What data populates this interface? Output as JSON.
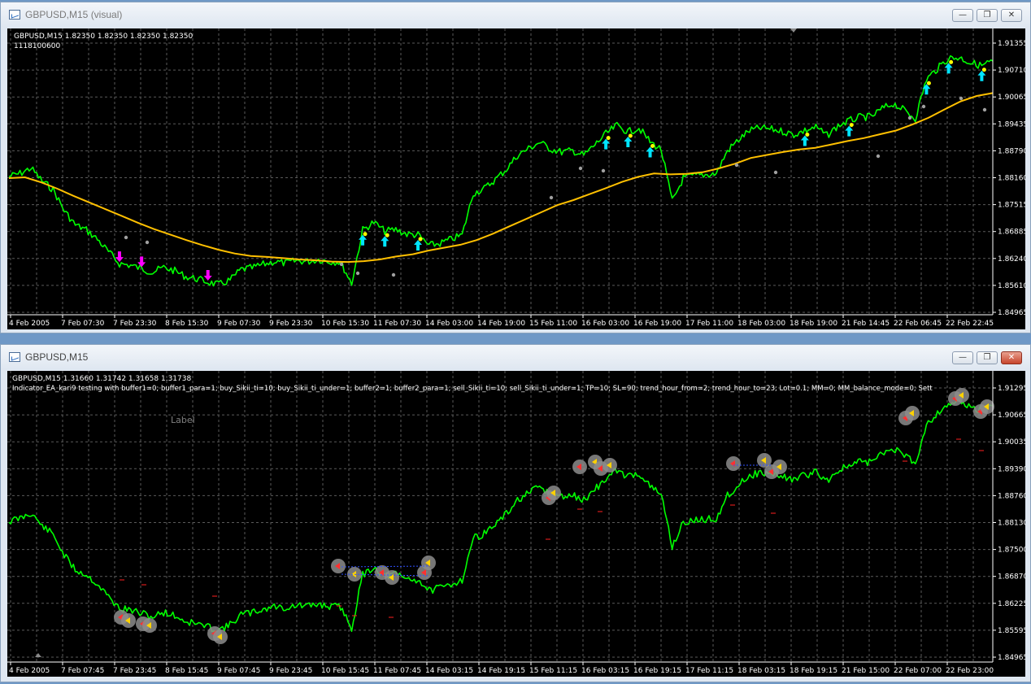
{
  "window_top": {
    "title": "GBPUSD,M15 (visual)",
    "header_line1": "GBPUSD,M15  1.82350 1.82350 1.82350 1.82350",
    "header_line2": "1118100600",
    "price_ticks": [
      "1.91355",
      "1.90710",
      "1.90065",
      "1.89435",
      "1.88790",
      "1.88160",
      "1.87515",
      "1.86885",
      "1.86240",
      "1.85610",
      "1.84965"
    ],
    "time_ticks": [
      "4 Feb 2005",
      "7 Feb 07:30",
      "7 Feb 23:30",
      "8 Feb 15:30",
      "9 Feb 07:30",
      "9 Feb 23:30",
      "10 Feb 15:30",
      "11 Feb 07:30",
      "14 Feb 03:00",
      "14 Feb 19:00",
      "15 Feb 11:00",
      "16 Feb 03:00",
      "16 Feb 19:00",
      "17 Feb 11:00",
      "18 Feb 03:00",
      "18 Feb 19:00",
      "21 Feb 14:45",
      "22 Feb 06:45",
      "22 Feb 22:45"
    ]
  },
  "window_bottom": {
    "title": "GBPUSD,M15",
    "header_line1": "GBPUSD,M15  1.31660 1.31742 1.31658 1.31738",
    "header_line2": "Indicator_EA_kari9 testing with buffer1=0; buffer1_para=1; buy_Sikii_ti=10; buy_Sikii_ti_under=1; buffer2=1; buffer2_para=1; sell_Sikii_ti=10; sell_Sikii_ti_under=1; TP=10; SL=90; trend_hour_from=2; trend_hour_to=23; Lot=0.1; MM=0; MM_balance_mode=0; Sett",
    "label_text": "Label",
    "price_ticks": [
      "1.91295",
      "1.90665",
      "1.90035",
      "1.89390",
      "1.88760",
      "1.88130",
      "1.87500",
      "1.86870",
      "1.86225",
      "1.85595",
      "1.84965"
    ],
    "time_ticks": [
      "4 Feb 2005",
      "7 Feb 07:45",
      "7 Feb 23:45",
      "8 Feb 15:45",
      "9 Feb 07:45",
      "9 Feb 23:45",
      "10 Feb 15:45",
      "11 Feb 07:45",
      "14 Feb 03:15",
      "14 Feb 19:15",
      "15 Feb 11:15",
      "16 Feb 03:15",
      "16 Feb 19:15",
      "17 Feb 11:15",
      "18 Feb 03:15",
      "18 Feb 19:15",
      "21 Feb 15:00",
      "22 Feb 07:00",
      "22 Feb 23:00"
    ]
  },
  "controls": {
    "minimize": "—",
    "restore": "❐",
    "close": "✕"
  },
  "colors": {
    "price": "#00ff00",
    "ma": "#ffc000",
    "grid": "#5a5a5a",
    "buy_arrow": "#00e5ff",
    "sell_arrow": "#ff00ff",
    "stop_dot": "#a0a0a0"
  },
  "chart_data": {
    "type": "line",
    "series": [
      {
        "name": "",
        "y": [
          1.8819,
          1.8826,
          1.8839,
          1.8808,
          1.8788,
          1.8738,
          1.8704,
          1.8692,
          1.867,
          1.864,
          1.8612,
          1.8608,
          1.86,
          1.8592,
          1.8603,
          1.8595,
          1.8581,
          1.8576,
          1.8568,
          1.8562,
          1.8573,
          1.8598,
          1.8602,
          1.861,
          1.8617,
          1.8613,
          1.8619,
          1.8617,
          1.8622,
          1.8617,
          1.8616,
          1.8565,
          1.8692,
          1.871,
          1.8689,
          1.8693,
          1.8682,
          1.868,
          1.8655,
          1.866,
          1.867,
          1.868,
          1.8779,
          1.879,
          1.8812,
          1.8836,
          1.8869,
          1.8885,
          1.89,
          1.8884,
          1.8877,
          1.888,
          1.8869,
          1.8894,
          1.892,
          1.894,
          1.8925,
          1.8934,
          1.8901,
          1.8883,
          1.876,
          1.8815,
          1.8821,
          1.8823,
          1.8826,
          1.888,
          1.8906,
          1.8928,
          1.8934,
          1.8931,
          1.8926,
          1.8918,
          1.8928,
          1.8936,
          1.8916,
          1.8939,
          1.8951,
          1.896,
          1.896,
          1.898,
          1.8992,
          1.8976,
          1.8957,
          1.905,
          1.9075,
          1.91,
          1.9101,
          1.9089,
          1.9082,
          1.9093
        ]
      },
      {
        "name": "",
        "y": [
          1.8815,
          1.8817,
          1.8805,
          1.879,
          1.8773,
          1.8757,
          1.8741,
          1.8725,
          1.8709,
          1.8694,
          1.8681,
          1.8668,
          1.8656,
          1.8645,
          1.8636,
          1.863,
          1.8628,
          1.8625,
          1.8622,
          1.862,
          1.8617,
          1.8616,
          1.8618,
          1.8622,
          1.8629,
          1.8634,
          1.8643,
          1.865,
          1.8657,
          1.8668,
          1.8683,
          1.87,
          1.8717,
          1.8734,
          1.8751,
          1.8763,
          1.8777,
          1.8791,
          1.8806,
          1.8818,
          1.8826,
          1.8824,
          1.8825,
          1.8829,
          1.8838,
          1.8849,
          1.8863,
          1.887,
          1.8877,
          1.8883,
          1.8887,
          1.8895,
          1.8903,
          1.891,
          1.8919,
          1.8928,
          1.8942,
          1.8958,
          1.8978,
          1.8997,
          1.901,
          1.9017
        ]
      }
    ],
    "ylim": [
      1.84965,
      1.91355
    ]
  }
}
